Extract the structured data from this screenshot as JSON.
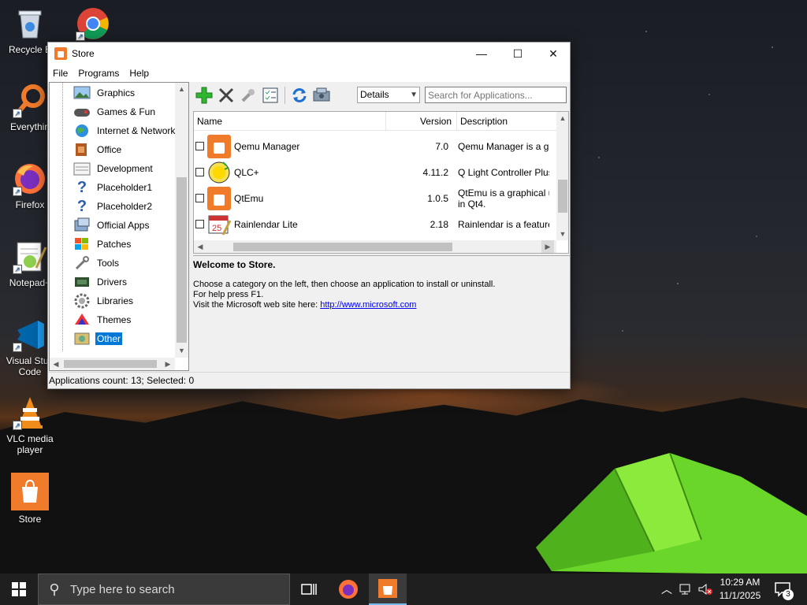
{
  "desktop": {
    "icons": [
      {
        "label": "Recycle B"
      },
      {
        "label": "Everythin"
      },
      {
        "label": "Firefox"
      },
      {
        "label": "Notepad+"
      },
      {
        "label": "Visual Stud",
        "label2": "Code"
      },
      {
        "label": "VLC media",
        "label2": "player"
      },
      {
        "label": "Store"
      }
    ]
  },
  "window": {
    "title": "Store",
    "controls": {
      "minimize": "—",
      "maximize": "☐",
      "close": "✕"
    },
    "menu": [
      "File",
      "Programs",
      "Help"
    ],
    "categories": [
      "Graphics",
      "Games & Fun",
      "Internet & Network",
      "Office",
      "Development",
      "Placeholder1",
      "Placeholder2",
      "Official Apps",
      "Patches",
      "Tools",
      "Drivers",
      "Libraries",
      "Themes",
      "Other"
    ],
    "selected_category": "Other",
    "toolbar": {
      "install_icon": "plus-icon",
      "uninstall_icon": "x-icon",
      "modify_icon": "wrench-icon",
      "checklist_icon": "checklist-icon",
      "refresh_icon": "refresh-icon",
      "update_icon": "update-icon"
    },
    "view_select": "Details",
    "search_placeholder": "Search for Applications...",
    "columns": {
      "name": "Name",
      "version": "Version",
      "description": "Description"
    },
    "apps": [
      {
        "name": "Qemu Manager",
        "version": "7.0",
        "desc1": "Qemu Manager is a gra",
        "desc2": ""
      },
      {
        "name": "QLC+",
        "version": "4.11.2",
        "desc1": "Q Light Controller Plus",
        "desc2": ""
      },
      {
        "name": "QtEmu",
        "version": "1.0.5",
        "desc1": "QtEmu is a graphical u",
        "desc2": "in Qt4."
      },
      {
        "name": "Rainlendar Lite",
        "version": "2.18",
        "desc1": "Rainlendar is a feature",
        "desc2": ""
      }
    ],
    "info": {
      "heading": "Welcome to Store.",
      "line1": "Choose a category on the left, then choose an application to install or uninstall.",
      "line2": "For help press F1.",
      "line3_prefix": "Visit the Microsoft web site here: ",
      "link": "http://www.microsoft.com"
    },
    "status": "Applications count: 13; Selected: 0"
  },
  "taskbar": {
    "search_placeholder": "Type here to search",
    "time": "10:29 AM",
    "date": "11/1/2025",
    "notification_count": "3"
  },
  "colors": {
    "accent": "#0078d7",
    "store_orange": "#f07b2a",
    "taskbar": "#1f1f1f"
  }
}
